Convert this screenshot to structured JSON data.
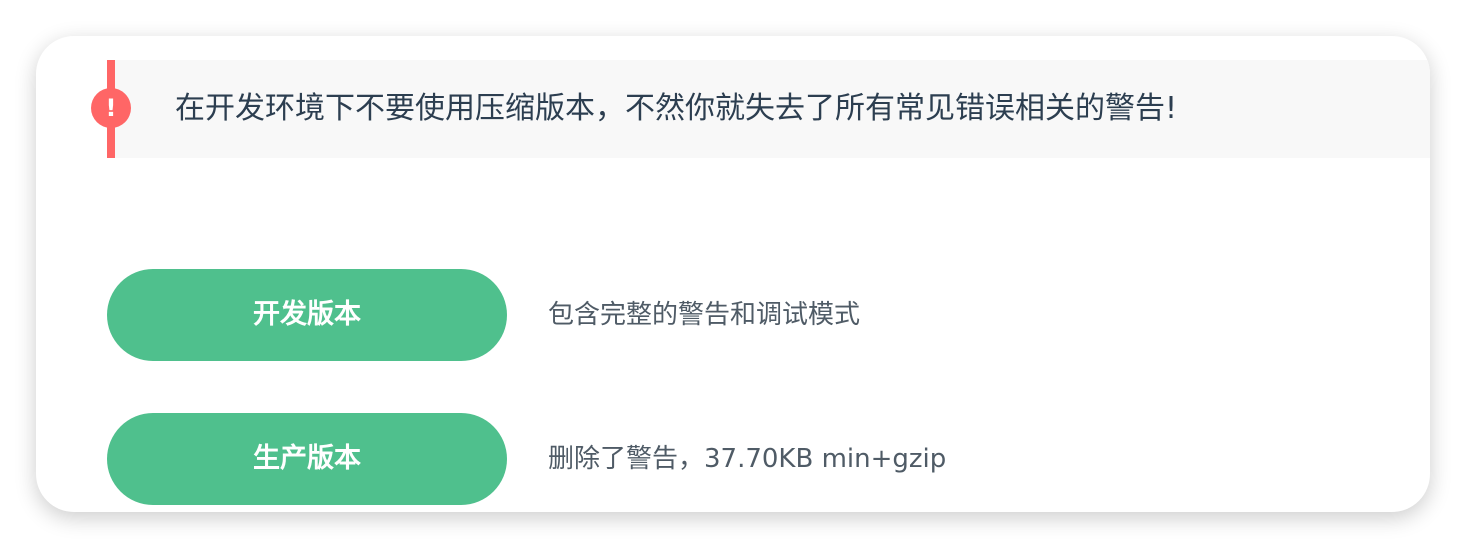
{
  "warning": {
    "icon": "exclamation-icon",
    "icon_glyph": "!",
    "text": "在开发环境下不要使用压缩版本，不然你就失去了所有常见错误相关的警告!",
    "accent_color": "#ff6666"
  },
  "downloads": {
    "dev": {
      "button_label": "开发版本",
      "description": "包含完整的警告和调试模式"
    },
    "prod": {
      "button_label": "生产版本",
      "description": "删除了警告，37.70KB min+gzip"
    }
  },
  "colors": {
    "brand_green": "#4fc08d",
    "text_dark": "#2c3e50",
    "text_muted": "#4f5b66",
    "warning_bg": "#f8f8f8"
  }
}
